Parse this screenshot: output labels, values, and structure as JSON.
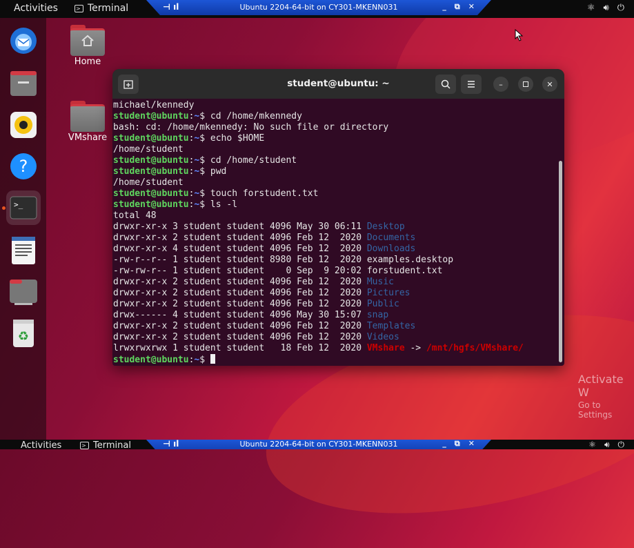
{
  "topbar": {
    "activities": "Activities",
    "app_name": "Terminal",
    "vm_title": "Ubuntu 2204-64-bit on CY301-MKENN031"
  },
  "bottombar": {
    "activities": "Activities",
    "app_name": "Terminal",
    "vm_title": "Ubuntu 2204-64-bit on CY301-MKENN031"
  },
  "desktop": {
    "icons": [
      {
        "label": "Home"
      },
      {
        "label": "VMshare"
      }
    ]
  },
  "dock": {
    "items": [
      "thunderbird-icon",
      "files-icon",
      "rhythmbox-icon",
      "help-icon",
      "terminal-icon",
      "text-editor-icon",
      "shared-folder-icon",
      "trash-icon"
    ]
  },
  "terminal": {
    "title": "student@ubuntu: ~",
    "prompt_user": "student@ubuntu",
    "prompt_path": "~",
    "lines": [
      {
        "t": "out",
        "text": "michael/kennedy"
      },
      {
        "t": "cmd",
        "text": "cd /home/mkennedy"
      },
      {
        "t": "out",
        "text": "bash: cd: /home/mkennedy: No such file or directory"
      },
      {
        "t": "cmd",
        "text": "echo $HOME"
      },
      {
        "t": "out",
        "text": "/home/student"
      },
      {
        "t": "cmd",
        "text": "cd /home/student"
      },
      {
        "t": "cmd",
        "text": "pwd"
      },
      {
        "t": "out",
        "text": "/home/student"
      },
      {
        "t": "cmd",
        "text": "touch forstudent.txt"
      },
      {
        "t": "cmd",
        "text": "ls -l"
      },
      {
        "t": "out",
        "text": "total 48"
      },
      {
        "t": "ls",
        "prefix": "drwxr-xr-x 3 student student 4096 May 30 06:11 ",
        "name": "Desktop",
        "kind": "dir"
      },
      {
        "t": "ls",
        "prefix": "drwxr-xr-x 2 student student 4096 Feb 12  2020 ",
        "name": "Documents",
        "kind": "dir"
      },
      {
        "t": "ls",
        "prefix": "drwxr-xr-x 4 student student 4096 Feb 12  2020 ",
        "name": "Downloads",
        "kind": "dir"
      },
      {
        "t": "ls",
        "prefix": "-rw-r--r-- 1 student student 8980 Feb 12  2020 ",
        "name": "examples.desktop",
        "kind": "file"
      },
      {
        "t": "ls",
        "prefix": "-rw-rw-r-- 1 student student    0 Sep  9 20:02 ",
        "name": "forstudent.txt",
        "kind": "file"
      },
      {
        "t": "ls",
        "prefix": "drwxr-xr-x 2 student student 4096 Feb 12  2020 ",
        "name": "Music",
        "kind": "dir"
      },
      {
        "t": "ls",
        "prefix": "drwxr-xr-x 2 student student 4096 Feb 12  2020 ",
        "name": "Pictures",
        "kind": "dir"
      },
      {
        "t": "ls",
        "prefix": "drwxr-xr-x 2 student student 4096 Feb 12  2020 ",
        "name": "Public",
        "kind": "dir"
      },
      {
        "t": "ls",
        "prefix": "drwx------ 4 student student 4096 May 30 15:07 ",
        "name": "snap",
        "kind": "dir"
      },
      {
        "t": "ls",
        "prefix": "drwxr-xr-x 2 student student 4096 Feb 12  2020 ",
        "name": "Templates",
        "kind": "dir"
      },
      {
        "t": "ls",
        "prefix": "drwxr-xr-x 2 student student 4096 Feb 12  2020 ",
        "name": "Videos",
        "kind": "dir"
      },
      {
        "t": "ls",
        "prefix": "lrwxrwxrwx 1 student student   18 Feb 12  2020 ",
        "name": "VMshare",
        "kind": "link",
        "arrow": " -> ",
        "target": "/mnt/hgfs/VMshare/"
      },
      {
        "t": "prompt"
      }
    ]
  },
  "watermark": {
    "line1": "Activate W",
    "line2": "Go to Settings"
  },
  "colors": {
    "terminal_bg": "#300a24",
    "prompt_user": "#5fd75f",
    "prompt_path": "#5f87ff",
    "dir": "#3465a4",
    "link": "#cc0000",
    "vm_bar": "#1d56d6"
  }
}
